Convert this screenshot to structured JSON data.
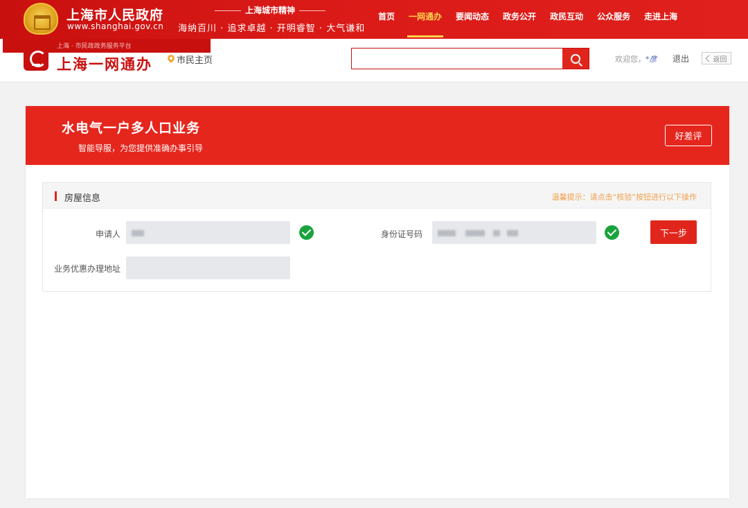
{
  "gov_header": {
    "title": "上海市人民政府",
    "url": "www.shanghai.gov.cn",
    "spirit_title": "上海城市精神",
    "spirit_text": "海纳百川 · 追求卓越 · 开明睿智 · 大气谦和",
    "nav": [
      {
        "label": "首页"
      },
      {
        "label": "一网通办",
        "active": true
      },
      {
        "label": "要闻动态"
      },
      {
        "label": "政务公开"
      },
      {
        "label": "政民互动"
      },
      {
        "label": "公众服务"
      },
      {
        "label": "走进上海"
      }
    ]
  },
  "sub_header": {
    "overlay_text": "上海 · 市民政政务服务平台",
    "brand": "上海一网通办",
    "home_link": "市民主页",
    "search_placeholder": "",
    "welcome_prefix": "欢迎您，",
    "welcome_user": "*彦",
    "logout": "退出",
    "back": "返回"
  },
  "card": {
    "title": "水电气一户多人口业务",
    "subtitle": "智能导服，为您提供准确办事引导",
    "rate_button": "好差评"
  },
  "panel": {
    "title": "房屋信息",
    "tip": "温馨提示：请点击“核验”按钮进行以下操作",
    "applicant_label": "申请人",
    "id_label": "身份证号码",
    "address_label": "业务优惠办理地址",
    "next_button": "下一步"
  },
  "colors": {
    "brand_red": "#e0261c",
    "success_green": "#19a33c",
    "tip_orange": "#f0a04b"
  }
}
